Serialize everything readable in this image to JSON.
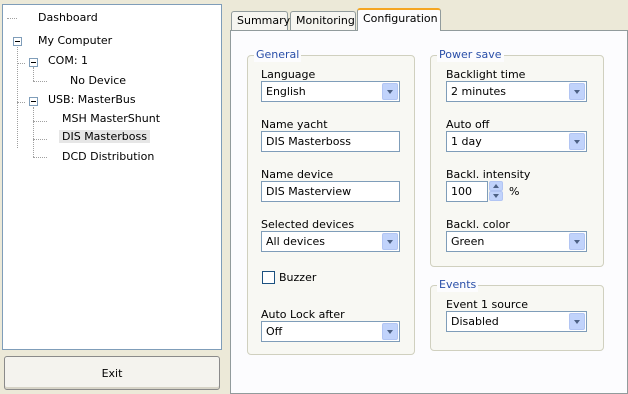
{
  "tree": {
    "items": [
      {
        "label": "Dashboard"
      },
      {
        "label": "My Computer"
      },
      {
        "label": "COM: 1"
      },
      {
        "label": "No Device"
      },
      {
        "label": "USB: MasterBus"
      },
      {
        "label": "MSH MasterShunt"
      },
      {
        "label": "DIS Masterboss"
      },
      {
        "label": "DCD Distribution"
      }
    ],
    "selected": "DIS Masterboss"
  },
  "exit_button": {
    "label": "Exit"
  },
  "tabs": [
    {
      "label": "Summary",
      "active": false
    },
    {
      "label": "Monitoring",
      "active": false
    },
    {
      "label": "Configuration",
      "active": true
    }
  ],
  "general": {
    "legend": "General",
    "language": {
      "label": "Language",
      "value": "English"
    },
    "name_yacht": {
      "label": "Name yacht",
      "value": "DIS Masterboss"
    },
    "name_device": {
      "label": "Name device",
      "value": "DIS Masterview"
    },
    "selected_devices": {
      "label": "Selected devices",
      "value": "All devices"
    },
    "buzzer": {
      "label": "Buzzer",
      "checked": false
    },
    "auto_lock": {
      "label": "Auto Lock after",
      "value": "Off"
    }
  },
  "power_save": {
    "legend": "Power save",
    "backlight_time": {
      "label": "Backlight time",
      "value": "2 minutes"
    },
    "auto_off": {
      "label": "Auto off",
      "value": "1 day"
    },
    "backl_intensity": {
      "label": "Backl. intensity",
      "value": "100",
      "unit": "%"
    },
    "backl_color": {
      "label": "Backl. color",
      "value": "Green"
    }
  },
  "events": {
    "legend": "Events",
    "event1_source": {
      "label": "Event 1 source",
      "value": "Disabled"
    }
  },
  "colors": {
    "legend": "#2a4fa8",
    "tab_active_accent": "#f5a623",
    "input_border": "#7f9db9"
  }
}
